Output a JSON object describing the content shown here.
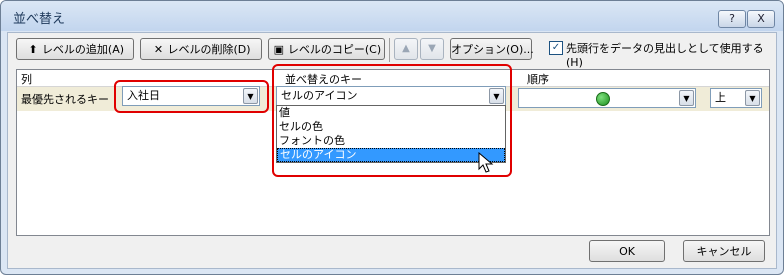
{
  "window": {
    "title": "並べ替え",
    "help_label": "?",
    "close_label": "X"
  },
  "toolbar": {
    "add_level": "レベルの追加(A)",
    "delete_level": "レベルの削除(D)",
    "copy_level": "レベルのコピー(C)",
    "move_up": "▲",
    "move_down": "▼",
    "options": "オプション(O)...",
    "header_checkbox_label": "先頭行をデータの見出しとして使用する(H)",
    "header_checkbox_checked": true
  },
  "grid": {
    "headers": {
      "column": "列",
      "sort_on": "並べ替えのキー",
      "order": "順序"
    },
    "row": {
      "label": "最優先されるキー",
      "column_value": "入社日",
      "sort_on_value": "セルのアイコン",
      "order_value": "上"
    }
  },
  "dropdown": {
    "options": [
      "値",
      "セルの色",
      "フォントの色",
      "セルのアイコン"
    ],
    "selected_index": 3
  },
  "footer": {
    "ok": "OK",
    "cancel": "キャンセル"
  },
  "colors": {
    "highlight": "#e00000",
    "selection": "#3399ff",
    "row_background": "#f0ecd8"
  },
  "icons": {
    "order_icon": "green-circle-icon"
  }
}
